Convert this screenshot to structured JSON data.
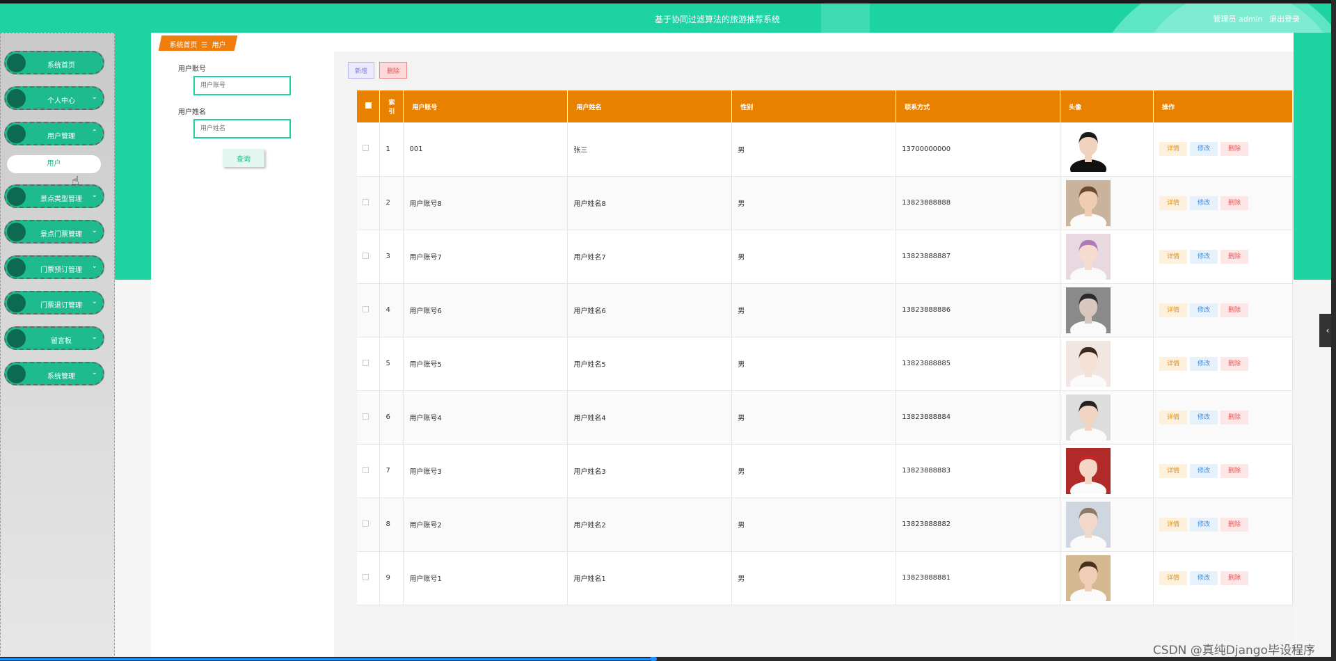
{
  "header": {
    "title": "基于协同过滤算法的旅游推荐系统",
    "user_label": "管理员 admin",
    "logout": "退出登录"
  },
  "sidebar": {
    "items": [
      {
        "label": "系统首页",
        "chevron": ""
      },
      {
        "label": "个人中心",
        "chevron": "⌄"
      },
      {
        "label": "用户管理",
        "chevron": "⌃"
      },
      {
        "label": "景点类型管理",
        "chevron": "⌄"
      },
      {
        "label": "景点门票管理",
        "chevron": "⌄"
      },
      {
        "label": "门票预订管理",
        "chevron": "⌄"
      },
      {
        "label": "门票退订管理",
        "chevron": "⌄"
      },
      {
        "label": "留言板",
        "chevron": "⌄"
      },
      {
        "label": "系统管理",
        "chevron": "⌄"
      }
    ],
    "sub_item": "用户"
  },
  "breadcrumb": {
    "home": "系统首页",
    "sep": "☰",
    "current": "用户"
  },
  "search": {
    "account_label": "用户账号",
    "account_placeholder": "用户账号",
    "name_label": "用户姓名",
    "name_placeholder": "用户姓名",
    "query_button": "查询"
  },
  "toolbar": {
    "add": "新增",
    "delete": "删除"
  },
  "table": {
    "columns": [
      "",
      "索引",
      "用户账号",
      "用户姓名",
      "性别",
      "联系方式",
      "头像",
      "操作"
    ],
    "index_header": [
      "索",
      "引"
    ],
    "ops": {
      "detail": "详情",
      "edit": "修改",
      "delete": "删除"
    },
    "rows": [
      {
        "index": "1",
        "account": "001",
        "name": "张三",
        "gender": "男",
        "phone": "13700000000"
      },
      {
        "index": "2",
        "account": "用户账号8",
        "name": "用户姓名8",
        "gender": "男",
        "phone": "13823888888"
      },
      {
        "index": "3",
        "account": "用户账号7",
        "name": "用户姓名7",
        "gender": "男",
        "phone": "13823888887"
      },
      {
        "index": "4",
        "account": "用户账号6",
        "name": "用户姓名6",
        "gender": "男",
        "phone": "13823888886"
      },
      {
        "index": "5",
        "account": "用户账号5",
        "name": "用户姓名5",
        "gender": "男",
        "phone": "13823888885"
      },
      {
        "index": "6",
        "account": "用户账号4",
        "name": "用户姓名4",
        "gender": "男",
        "phone": "13823888884"
      },
      {
        "index": "7",
        "account": "用户账号3",
        "name": "用户姓名3",
        "gender": "男",
        "phone": "13823888883"
      },
      {
        "index": "8",
        "account": "用户账号2",
        "name": "用户姓名2",
        "gender": "男",
        "phone": "13823888882"
      },
      {
        "index": "9",
        "account": "用户账号1",
        "name": "用户姓名1",
        "gender": "男",
        "phone": "13823888881"
      }
    ]
  },
  "watermark": "CSDN @真纯Django毕设程序",
  "colors": {
    "primary": "#1dd3a2",
    "sidebar_item": "#1dbb8d",
    "table_header": "#e88100",
    "breadcrumb": "#f07e0c"
  }
}
